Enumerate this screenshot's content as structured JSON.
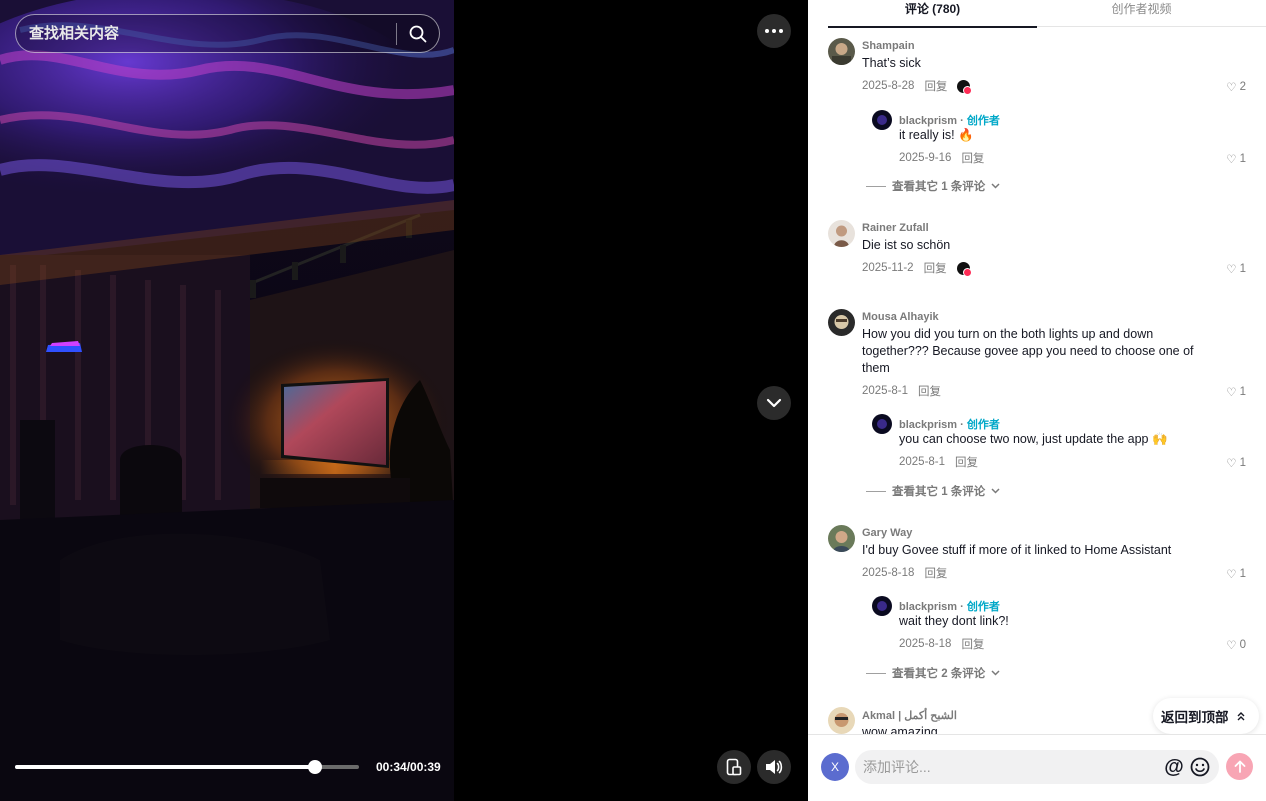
{
  "search": {
    "placeholder": "查找相关内容"
  },
  "player": {
    "time": "00:34/00:39",
    "progress_fraction": 0.872
  },
  "tabs": [
    {
      "label": "评论 (780)",
      "active": true
    },
    {
      "label": "创作者视频",
      "active": false
    }
  ],
  "author_tag": "创作者",
  "comments": [
    {
      "user": "Shampain",
      "text": "That’s sick",
      "date": "2025-8-28",
      "reply": "回复",
      "likes": "2",
      "creator_liked": true,
      "replies": [
        {
          "user": "blackprism",
          "text": "it really is! 🔥",
          "date": "2025-9-16",
          "reply": "回复",
          "likes": "1"
        }
      ],
      "more": "查看其它 1 条评论"
    },
    {
      "user": "Rainer Zufall",
      "text": "Die ist so schön",
      "date": "2025-11-2",
      "reply": "回复",
      "likes": "1",
      "creator_liked": true,
      "replies": [],
      "more": ""
    },
    {
      "user": "Mousa Alhayik",
      "text": "How you did you turn on the both lights up and down together??? Because govee app you need to choose one of them",
      "date": "2025-8-1",
      "reply": "回复",
      "likes": "1",
      "creator_liked": false,
      "replies": [
        {
          "user": "blackprism",
          "text": "you can choose two now, just update the app 🙌",
          "date": "2025-8-1",
          "reply": "回复",
          "likes": "1"
        }
      ],
      "more": "查看其它 1 条评论"
    },
    {
      "user": "Gary Way",
      "text": "I'd buy Govee stuff if more of it linked to Home Assistant",
      "date": "2025-8-18",
      "reply": "回复",
      "likes": "1",
      "creator_liked": false,
      "replies": [
        {
          "user": "blackprism",
          "text": "wait they dont link?!",
          "date": "2025-8-18",
          "reply": "回复",
          "likes": "0"
        }
      ],
      "more": "查看其它 2 条评论"
    },
    {
      "user": "Akmal | الشبح أكمل",
      "text": "wow amazing",
      "date": "",
      "reply": "",
      "likes": "",
      "creator_liked": false,
      "replies": [],
      "more": ""
    }
  ],
  "back_to_top": "返回到顶部",
  "composer": {
    "avatar_letter": "X",
    "placeholder": "添加评论..."
  },
  "colors": {
    "accent": "#fe2c55",
    "author": "#00a8c8",
    "send_disabled": "#f8a5b4"
  }
}
